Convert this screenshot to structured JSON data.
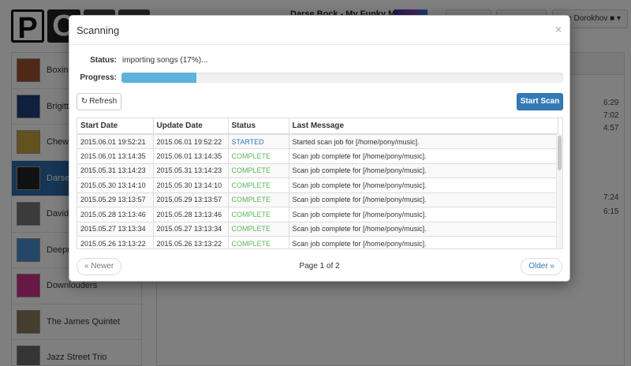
{
  "app": {
    "logo_letters": [
      "P",
      "O"
    ],
    "now_playing": "Darse Bock - My Funky Mo",
    "user_label": "e Dorokhov",
    "user_icon": "user-icon",
    "sidebar_items": [
      {
        "label": "Boxing",
        "art_color": "#a0522d"
      },
      {
        "label": "Brigitte",
        "art_color": "#1f3f7a"
      },
      {
        "label": "Chewba",
        "art_color": "#c4a43a"
      },
      {
        "label": "Darse",
        "art_color": "#222222",
        "active": true
      },
      {
        "label": "David T",
        "art_color": "#777777"
      },
      {
        "label": "Deepne",
        "art_color": "#4a8fcf"
      },
      {
        "label": "Downlouders",
        "art_color": "#d0308a"
      },
      {
        "label": "The James Quintet",
        "art_color": "#8a7a5a"
      },
      {
        "label": "Jazz Street Trio",
        "art_color": "#6a6a6a"
      }
    ],
    "track_durations": [
      "6:29",
      "7:02",
      "4:57",
      "7:24",
      "6:15"
    ]
  },
  "modal": {
    "title": "Scanning",
    "close_symbol": "×",
    "status_label": "Status:",
    "status_value": "importing songs (17%)...",
    "progress_label": "Progress:",
    "progress_fraction": 0.17,
    "refresh_label": "Refresh",
    "refresh_icon": "refresh-icon",
    "start_scan_label": "Start Scan",
    "table": {
      "headers": [
        "Start Date",
        "Update Date",
        "Status",
        "Last Message"
      ],
      "rows": [
        [
          "2015.06.01 19:52:21",
          "2015.06.01 19:52:22",
          "STARTED",
          "Started scan job for [/home/pony/music]."
        ],
        [
          "2015.06.01 13:14:35",
          "2015.06.01 13:14:35",
          "COMPLETE",
          "Scan job complete for [/home/pony/music]."
        ],
        [
          "2015.05.31 13:14:23",
          "2015.05.31 13:14:23",
          "COMPLETE",
          "Scan job complete for [/home/pony/music]."
        ],
        [
          "2015.05.30 13:14:10",
          "2015.05.30 13:14:10",
          "COMPLETE",
          "Scan job complete for [/home/pony/music]."
        ],
        [
          "2015.05.29 13:13:57",
          "2015.05.29 13:13:57",
          "COMPLETE",
          "Scan job complete for [/home/pony/music]."
        ],
        [
          "2015.05.28 13:13:46",
          "2015.05.28 13:13:46",
          "COMPLETE",
          "Scan job complete for [/home/pony/music]."
        ],
        [
          "2015.05.27 13:13:34",
          "2015.05.27 13:13:34",
          "COMPLETE",
          "Scan job complete for [/home/pony/music]."
        ],
        [
          "2015.05.26 13:13:22",
          "2015.05.26 13:13:22",
          "COMPLETE",
          "Scan job complete for [/home/pony/music]."
        ]
      ]
    },
    "newer_label": "« Newer",
    "older_label": "Older »",
    "page_info": "Page 1 of 2"
  },
  "colors": {
    "primary": "#337ab7",
    "progress": "#5bb3de",
    "status_started": "#337ab7",
    "status_complete": "#5cb85c"
  }
}
